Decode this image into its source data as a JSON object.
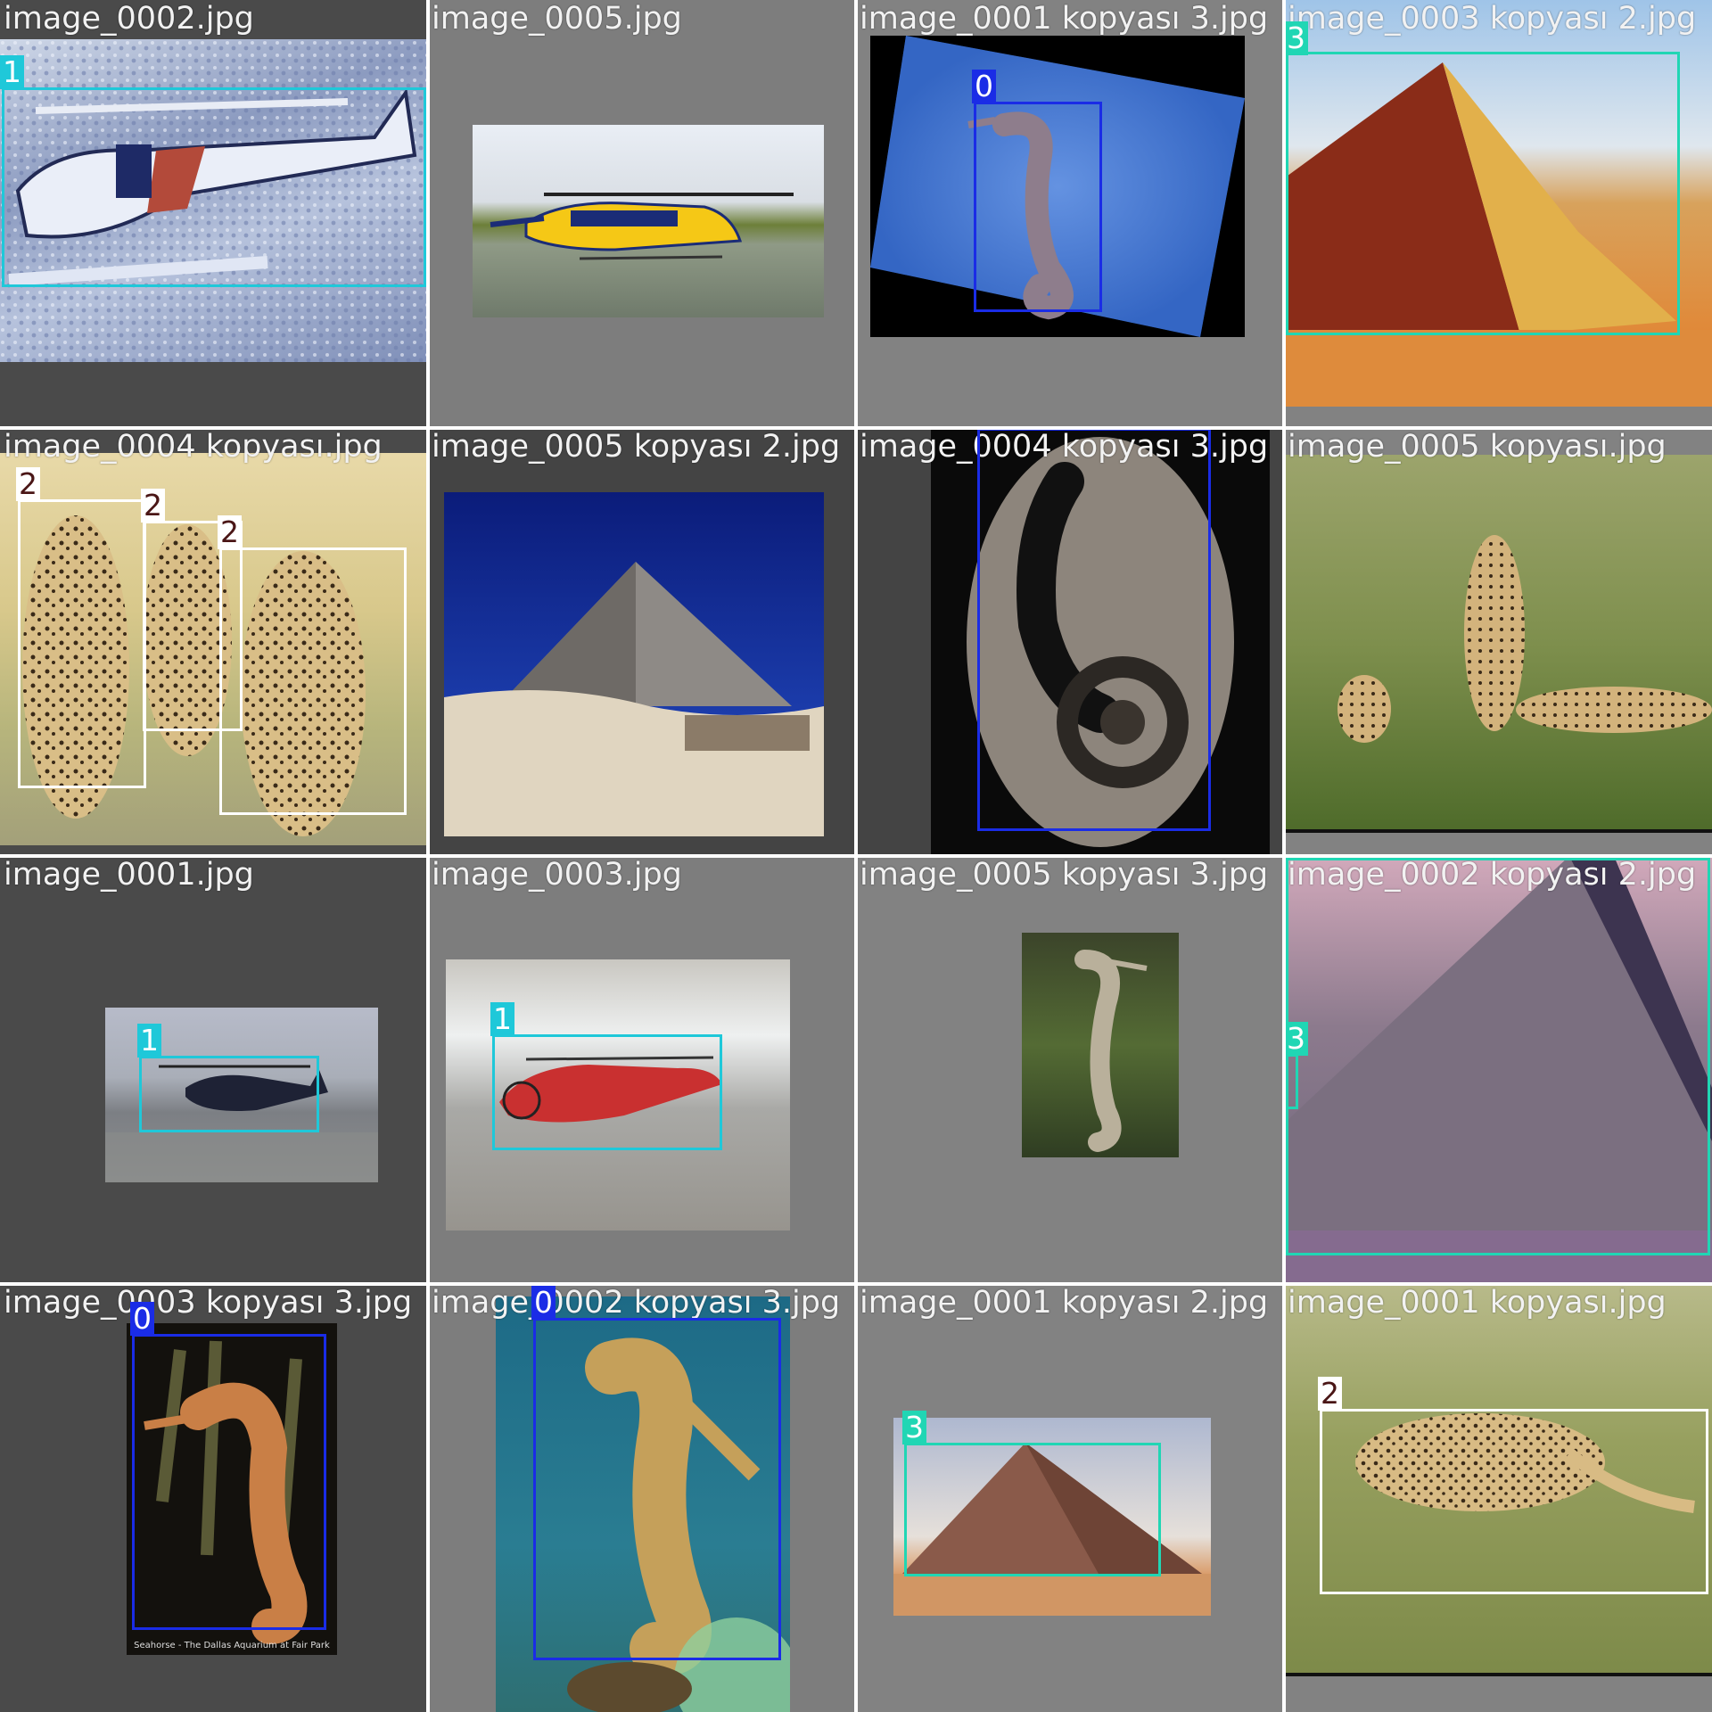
{
  "title": "",
  "class_colors": {
    "0": "#1a2ce6",
    "1": "#1fc8d9",
    "2": "#ffffff",
    "3": "#20d6b4"
  },
  "tiles": [
    {
      "filename": "image_0002.jpg",
      "scene": "helicopter-snow",
      "background": "#4a4a4a",
      "labels": [
        "1"
      ]
    },
    {
      "filename": "image_0005.jpg",
      "scene": "helicopter-yellow",
      "background": "#7d7d7d",
      "labels": []
    },
    {
      "filename": "image_0001 kopyası 3.jpg",
      "scene": "seahorse-blue",
      "background": "#828282",
      "labels": [
        "0"
      ]
    },
    {
      "filename": "image_0003 kopyası 2.jpg",
      "scene": "pyramid-desert",
      "background": "#828282",
      "labels": [
        "3"
      ]
    },
    {
      "filename": "image_0004 kopyası.jpg",
      "scene": "cheetahs-three",
      "background": "#4a4a4a",
      "labels": [
        "2",
        "2",
        "2"
      ]
    },
    {
      "filename": "image_0005 kopyası 2.jpg",
      "scene": "pyramid-blue-sky",
      "background": "#444444",
      "labels": []
    },
    {
      "filename": "image_0004 kopyası 3.jpg",
      "scene": "seahorse-fossil",
      "background": "#444444",
      "labels": [
        "0"
      ]
    },
    {
      "filename": "image_0005 kopyası.jpg",
      "scene": "cheetahs-field",
      "background": "#828282",
      "labels": []
    },
    {
      "filename": "image_0001.jpg",
      "scene": "helicopter-dark",
      "background": "#4a4a4a",
      "labels": [
        "1"
      ]
    },
    {
      "filename": "image_0003.jpg",
      "scene": "helicopter-red",
      "background": "#7d7d7d",
      "labels": [
        "1"
      ]
    },
    {
      "filename": "image_0005 kopyası 3.jpg",
      "scene": "seahorse-green",
      "background": "#828282",
      "labels": []
    },
    {
      "filename": "image_0002 kopyası 2.jpg",
      "scene": "pyramid-carved",
      "background": "#828282",
      "labels": [
        "3",
        "3"
      ]
    },
    {
      "filename": "image_0003 kopyası 3.jpg",
      "scene": "seahorse-orange",
      "background": "#4a4a4a",
      "labels": [
        "0"
      ],
      "caption": "Seahorse - The Dallas Aquarium at Fair Park"
    },
    {
      "filename": "image_0002 kopyası 3.jpg",
      "scene": "seahorse-teal",
      "background": "#7d7d7d",
      "labels": [
        "0"
      ]
    },
    {
      "filename": "image_0001 kopyası 2.jpg",
      "scene": "pyramid-giza",
      "background": "#828282",
      "labels": [
        "3"
      ]
    },
    {
      "filename": "image_0001 kopyası.jpg",
      "scene": "cheetah-walking",
      "background": "#828282",
      "labels": [
        "2"
      ]
    }
  ]
}
